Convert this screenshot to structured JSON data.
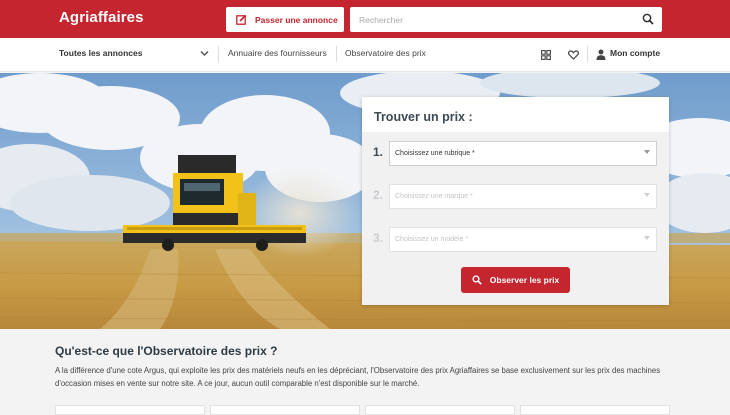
{
  "header": {
    "logo": "Agriaffaires",
    "post_ad_label": "Passer une annonce",
    "search_placeholder": "Rechercher"
  },
  "nav": {
    "all_ads": "Toutes les annonces",
    "suppliers": "Annuaire des fournisseurs",
    "price_observatory": "Observatoire des prix",
    "account": "Mon compte"
  },
  "finder": {
    "title": "Trouver un prix :",
    "steps": [
      {
        "num": "1.",
        "placeholder": "Choisissez une rubrique *"
      },
      {
        "num": "2.",
        "placeholder": "Choisissez une marque *"
      },
      {
        "num": "3.",
        "placeholder": "Choisissez un modèle *"
      }
    ],
    "submit_label": "Observer les prix"
  },
  "info": {
    "title": "Qu'est-ce que l'Observatoire des prix ?",
    "text": "A la différence d'une cote Argus, qui exploite les prix des matériels neufs en les dépréciant, l'Observatoire des prix Agriaffaires se base exclusivement sur les prix des machines d'occasion mises en vente sur notre site. A ce jour, aucun outil comparable n'est disponible sur le marché."
  },
  "colors": {
    "brand": "#c4252f",
    "active_step": "#3d4a54",
    "disabled_step": "#c9cdd1"
  }
}
